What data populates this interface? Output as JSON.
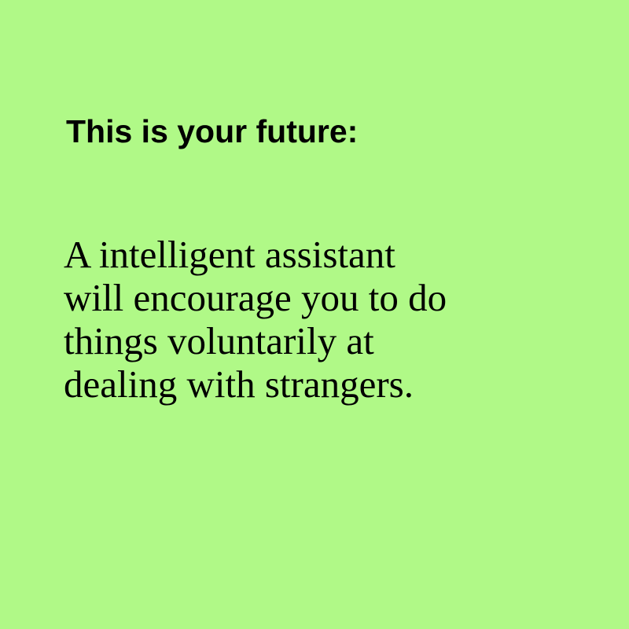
{
  "colors": {
    "background": "#b0f987",
    "text": "#000000"
  },
  "heading": "This is your future:",
  "body_lines": [
    "A intelligent assistant",
    "will encourage you to do",
    "things voluntarily at",
    "dealing with strangers."
  ]
}
